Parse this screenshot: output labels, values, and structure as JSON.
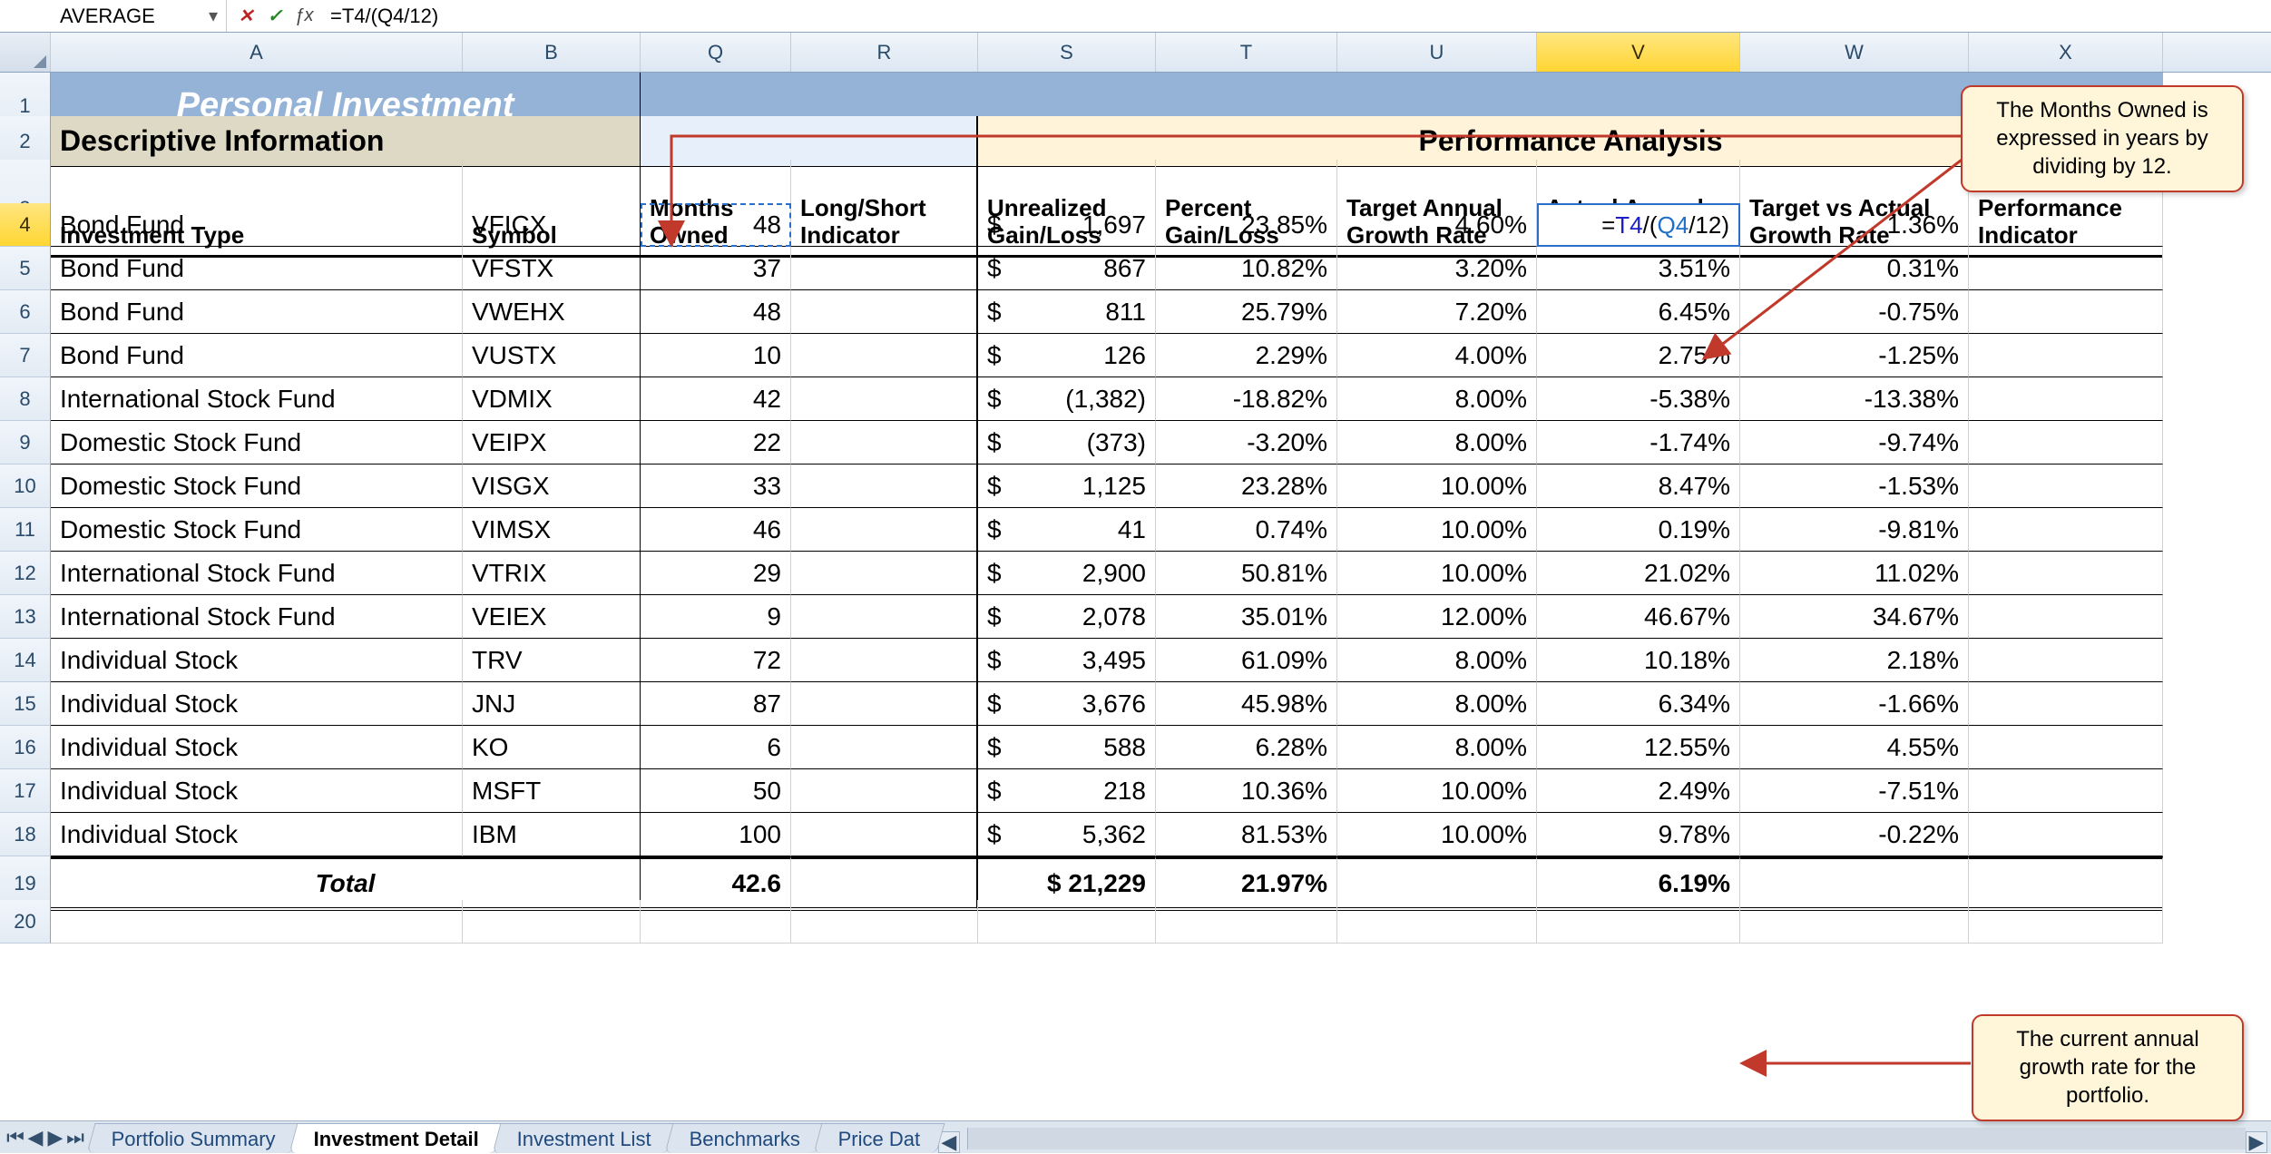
{
  "name_box": "AVERAGE",
  "formula": "=T4/(Q4/12)",
  "columns": [
    "",
    "A",
    "B",
    "Q",
    "R",
    "S",
    "T",
    "U",
    "V",
    "W",
    "X"
  ],
  "active_column": "V",
  "title": "Personal Investment",
  "sections": {
    "descriptive": "Descriptive Information",
    "performance": "Performance Analysis"
  },
  "headers": {
    "A": "Investment Type",
    "B": "Symbol",
    "Q": "Months Owned",
    "R": "Long/Short Indicator",
    "S": "Unrealized Gain/Loss",
    "T": "Percent Gain/Loss",
    "U": "Target Annual Growth Rate",
    "V": "Actual Annual Growth Rate",
    "W": "Target vs Actual Growth Rate",
    "X": "Performance Indicator"
  },
  "active_row": 4,
  "editing_cell_text": "=T4/(Q4/12)",
  "rows": [
    {
      "n": 4,
      "A": "Bond Fund",
      "B": "VFICX",
      "Q": "48",
      "S": "1,697",
      "T": "23.85%",
      "U": "4.60%",
      "V": "=T4/(Q4/12)",
      "W": "1.36%"
    },
    {
      "n": 5,
      "A": "Bond Fund",
      "B": "VFSTX",
      "Q": "37",
      "S": "867",
      "T": "10.82%",
      "U": "3.20%",
      "V": "3.51%",
      "W": "0.31%"
    },
    {
      "n": 6,
      "A": "Bond Fund",
      "B": "VWEHX",
      "Q": "48",
      "S": "811",
      "T": "25.79%",
      "U": "7.20%",
      "V": "6.45%",
      "W": "-0.75%"
    },
    {
      "n": 7,
      "A": "Bond Fund",
      "B": "VUSTX",
      "Q": "10",
      "S": "126",
      "T": "2.29%",
      "U": "4.00%",
      "V": "2.75%",
      "W": "-1.25%"
    },
    {
      "n": 8,
      "A": "International Stock Fund",
      "B": "VDMIX",
      "Q": "42",
      "S": "(1,382)",
      "T": "-18.82%",
      "U": "8.00%",
      "V": "-5.38%",
      "W": "-13.38%"
    },
    {
      "n": 9,
      "A": "Domestic Stock Fund",
      "B": "VEIPX",
      "Q": "22",
      "S": "(373)",
      "T": "-3.20%",
      "U": "8.00%",
      "V": "-1.74%",
      "W": "-9.74%"
    },
    {
      "n": 10,
      "A": "Domestic Stock Fund",
      "B": "VISGX",
      "Q": "33",
      "S": "1,125",
      "T": "23.28%",
      "U": "10.00%",
      "V": "8.47%",
      "W": "-1.53%"
    },
    {
      "n": 11,
      "A": "Domestic Stock Fund",
      "B": "VIMSX",
      "Q": "46",
      "S": "41",
      "T": "0.74%",
      "U": "10.00%",
      "V": "0.19%",
      "W": "-9.81%"
    },
    {
      "n": 12,
      "A": "International Stock Fund",
      "B": "VTRIX",
      "Q": "29",
      "S": "2,900",
      "T": "50.81%",
      "U": "10.00%",
      "V": "21.02%",
      "W": "11.02%"
    },
    {
      "n": 13,
      "A": "International Stock Fund",
      "B": "VEIEX",
      "Q": "9",
      "S": "2,078",
      "T": "35.01%",
      "U": "12.00%",
      "V": "46.67%",
      "W": "34.67%"
    },
    {
      "n": 14,
      "A": "Individual Stock",
      "B": "TRV",
      "Q": "72",
      "S": "3,495",
      "T": "61.09%",
      "U": "8.00%",
      "V": "10.18%",
      "W": "2.18%"
    },
    {
      "n": 15,
      "A": "Individual Stock",
      "B": "JNJ",
      "Q": "87",
      "S": "3,676",
      "T": "45.98%",
      "U": "8.00%",
      "V": "6.34%",
      "W": "-1.66%"
    },
    {
      "n": 16,
      "A": "Individual Stock",
      "B": "KO",
      "Q": "6",
      "S": "588",
      "T": "6.28%",
      "U": "8.00%",
      "V": "12.55%",
      "W": "4.55%"
    },
    {
      "n": 17,
      "A": "Individual Stock",
      "B": "MSFT",
      "Q": "50",
      "S": "218",
      "T": "10.36%",
      "U": "10.00%",
      "V": "2.49%",
      "W": "-7.51%"
    },
    {
      "n": 18,
      "A": "Individual Stock",
      "B": "IBM",
      "Q": "100",
      "S": "5,362",
      "T": "81.53%",
      "U": "10.00%",
      "V": "9.78%",
      "W": "-0.22%"
    }
  ],
  "total": {
    "label": "Total",
    "Q": "42.6",
    "S": "$ 21,229",
    "T": "21.97%",
    "V": "6.19%"
  },
  "row20": 20,
  "tabs": [
    "Portfolio Summary",
    "Investment Detail",
    "Investment List",
    "Benchmarks",
    "Price Dat"
  ],
  "active_tab": 1,
  "callouts": {
    "top": "The Months Owned is expressed in years by dividing by 12.",
    "bottom": "The current annual growth rate for the portfolio."
  },
  "chart_data": {
    "type": "table",
    "title": "Personal Investment — Investment Detail",
    "columns": [
      "Investment Type",
      "Symbol",
      "Months Owned",
      "Unrealized Gain/Loss ($)",
      "Percent Gain/Loss (%)",
      "Target Annual Growth Rate (%)",
      "Actual Annual Growth Rate (%)",
      "Target vs Actual Growth Rate (%)"
    ],
    "rows": [
      [
        "Bond Fund",
        "VFICX",
        48,
        1697,
        23.85,
        4.6,
        null,
        1.36
      ],
      [
        "Bond Fund",
        "VFSTX",
        37,
        867,
        10.82,
        3.2,
        3.51,
        0.31
      ],
      [
        "Bond Fund",
        "VWEHX",
        48,
        811,
        25.79,
        7.2,
        6.45,
        -0.75
      ],
      [
        "Bond Fund",
        "VUSTX",
        10,
        126,
        2.29,
        4.0,
        2.75,
        -1.25
      ],
      [
        "International Stock Fund",
        "VDMIX",
        42,
        -1382,
        -18.82,
        8.0,
        -5.38,
        -13.38
      ],
      [
        "Domestic Stock Fund",
        "VEIPX",
        22,
        -373,
        -3.2,
        8.0,
        -1.74,
        -9.74
      ],
      [
        "Domestic Stock Fund",
        "VISGX",
        33,
        1125,
        23.28,
        10.0,
        8.47,
        -1.53
      ],
      [
        "Domestic Stock Fund",
        "VIMSX",
        46,
        41,
        0.74,
        10.0,
        0.19,
        -9.81
      ],
      [
        "International Stock Fund",
        "VTRIX",
        29,
        2900,
        50.81,
        10.0,
        21.02,
        11.02
      ],
      [
        "International Stock Fund",
        "VEIEX",
        9,
        2078,
        35.01,
        12.0,
        46.67,
        34.67
      ],
      [
        "Individual Stock",
        "TRV",
        72,
        3495,
        61.09,
        8.0,
        10.18,
        2.18
      ],
      [
        "Individual Stock",
        "JNJ",
        87,
        3676,
        45.98,
        8.0,
        6.34,
        -1.66
      ],
      [
        "Individual Stock",
        "KO",
        6,
        588,
        6.28,
        8.0,
        12.55,
        4.55
      ],
      [
        "Individual Stock",
        "MSFT",
        50,
        218,
        10.36,
        10.0,
        2.49,
        -7.51
      ],
      [
        "Individual Stock",
        "IBM",
        100,
        5362,
        81.53,
        10.0,
        9.78,
        -0.22
      ]
    ],
    "totals": {
      "Months Owned (avg)": 42.6,
      "Unrealized Gain/Loss ($)": 21229,
      "Percent Gain/Loss (%)": 21.97,
      "Actual Annual Growth Rate (%)": 6.19
    }
  }
}
